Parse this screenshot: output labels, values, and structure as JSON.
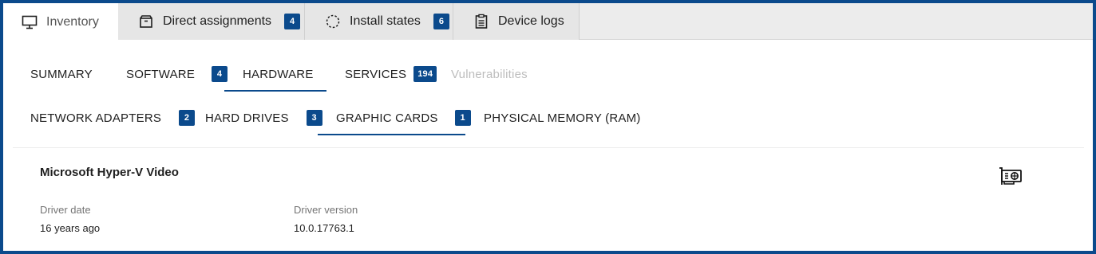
{
  "top_tabs": [
    {
      "label": "Inventory",
      "icon": "monitor-icon"
    },
    {
      "label": "Direct assignments",
      "icon": "package-icon",
      "badge": "4"
    },
    {
      "label": "Install states",
      "icon": "progress-circle-icon",
      "badge": "6"
    },
    {
      "label": "Device logs",
      "icon": "clipboard-icon"
    }
  ],
  "section_tabs": [
    {
      "label": "SUMMARY"
    },
    {
      "label": "SOFTWARE",
      "badge": "4"
    },
    {
      "label": "HARDWARE"
    },
    {
      "label": "SERVICES",
      "badge": "194"
    },
    {
      "label": "Vulnerabilities"
    }
  ],
  "hardware_tabs": [
    {
      "label": "NETWORK ADAPTERS",
      "badge": "2"
    },
    {
      "label": "HARD DRIVES",
      "badge": "3"
    },
    {
      "label": "GRAPHIC CARDS",
      "badge": "1"
    },
    {
      "label": "PHYSICAL MEMORY (RAM)"
    }
  ],
  "card": {
    "title": "Microsoft Hyper-V Video",
    "icon": "graphics-card-icon",
    "fields": [
      {
        "label": "Driver date",
        "value": "16 years ago"
      },
      {
        "label": "Driver version",
        "value": "10.0.17763.1"
      }
    ]
  },
  "colors": {
    "accent": "#0b4a8c",
    "disabled": "#bdbdbd",
    "tabbar": "#ececec"
  }
}
